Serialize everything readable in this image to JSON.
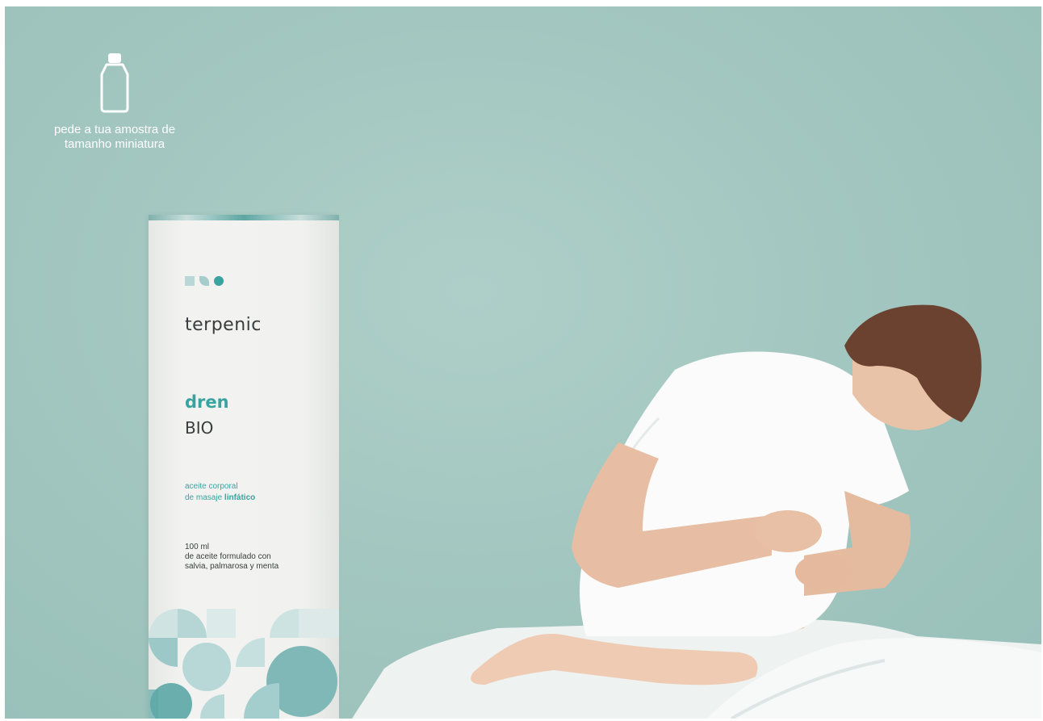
{
  "sample_cta": {
    "icon": "bottle-icon",
    "text": "pede a tua amostra de\ntamanho miniatura"
  },
  "product": {
    "brand": "terpenic",
    "name": "dren",
    "subname": "BIO",
    "description_line1": "aceite corporal",
    "description_line2_prefix": "de masaje ",
    "description_line2_highlight": "linfático",
    "volume": "100 ml",
    "detail_line1": "de aceite formulado con",
    "detail_line2": "salvia, palmarosa y menta"
  },
  "colors": {
    "background": "#a3c7c0",
    "brand_teal": "#3aa39f",
    "text_dark": "#3a3d3e"
  }
}
